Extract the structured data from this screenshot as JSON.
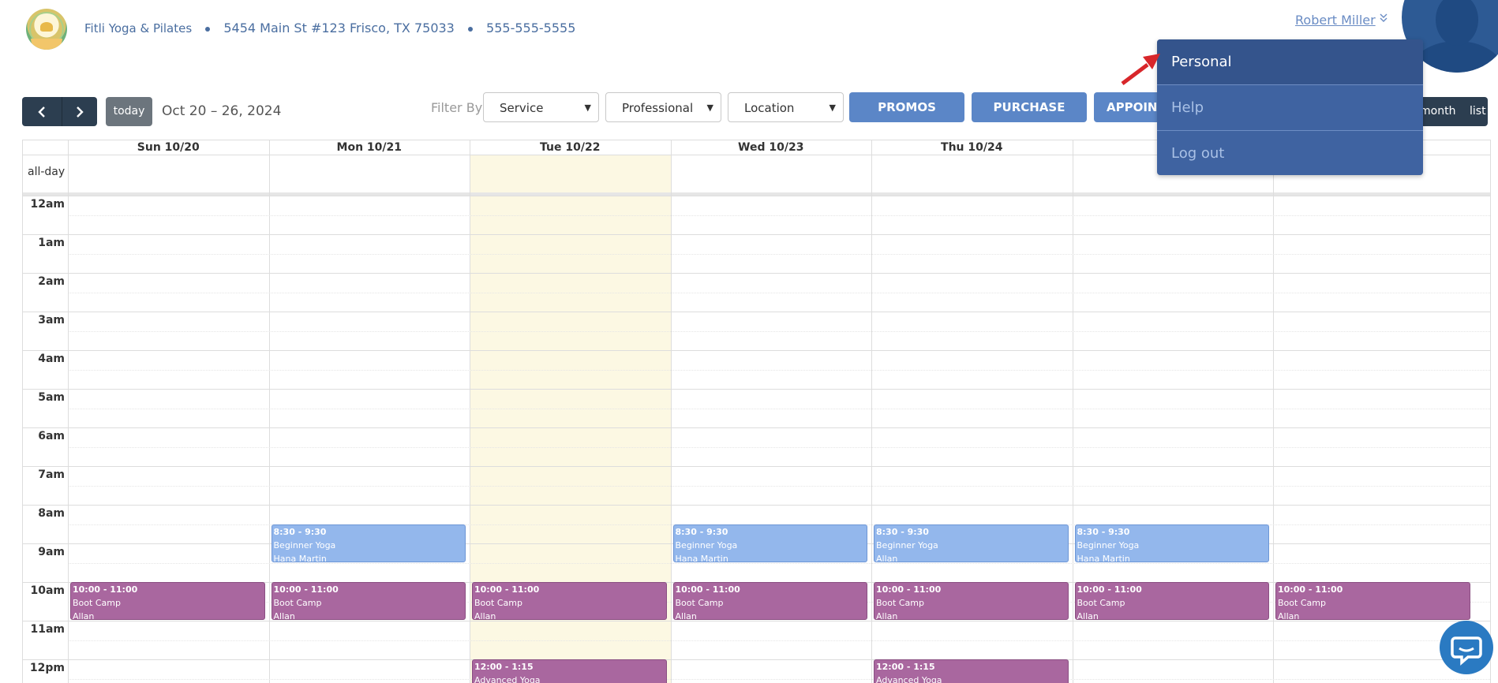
{
  "header": {
    "studio_name": "Fitli Yoga & Pilates",
    "address": "5454 Main St #123 Frisco, TX 75033",
    "phone": "555-555-5555",
    "user_name": "Robert Miller",
    "user_chevron": "»"
  },
  "toolbar": {
    "prev": "‹",
    "next": "›",
    "today": "today",
    "date_range": "Oct 20 – 26, 2024",
    "filter_label": "Filter By",
    "service": "Service",
    "professional": "Professional",
    "location": "Location",
    "promos": "PROMOS",
    "purchase": "PURCHASE",
    "appointments_partial": "APPOINT",
    "view_month": "month",
    "view_list": "list"
  },
  "calendar": {
    "days": [
      "Sun 10/20",
      "Mon 10/21",
      "Tue 10/22",
      "Wed 10/23",
      "Thu 10/24",
      "",
      ""
    ],
    "allday_label": "all-day",
    "hours": [
      "12am",
      "1am",
      "2am",
      "3am",
      "4am",
      "5am",
      "6am",
      "7am",
      "8am",
      "9am",
      "10am",
      "11am",
      "12pm"
    ],
    "events": [
      {
        "day": 1,
        "start": 8.5,
        "end": 9.5,
        "time": "8:30 - 9:30",
        "title": "Beginner Yoga",
        "who": "Hana Martin",
        "kind": "yoga"
      },
      {
        "day": 3,
        "start": 8.5,
        "end": 9.5,
        "time": "8:30 - 9:30",
        "title": "Beginner Yoga",
        "who": "Hana Martin",
        "kind": "yoga"
      },
      {
        "day": 4,
        "start": 8.5,
        "end": 9.5,
        "time": "8:30 - 9:30",
        "title": "Beginner Yoga",
        "who": "Allan",
        "kind": "yoga"
      },
      {
        "day": 5,
        "start": 8.5,
        "end": 9.5,
        "time": "8:30 - 9:30",
        "title": "Beginner Yoga",
        "who": "Hana Martin",
        "kind": "yoga"
      },
      {
        "day": 0,
        "start": 10,
        "end": 11,
        "time": "10:00 - 11:00",
        "title": "Boot Camp",
        "who": "Allan",
        "kind": "boot"
      },
      {
        "day": 1,
        "start": 10,
        "end": 11,
        "time": "10:00 - 11:00",
        "title": "Boot Camp",
        "who": "Allan",
        "kind": "boot"
      },
      {
        "day": 2,
        "start": 10,
        "end": 11,
        "time": "10:00 - 11:00",
        "title": "Boot Camp",
        "who": "Allan",
        "kind": "boot"
      },
      {
        "day": 3,
        "start": 10,
        "end": 11,
        "time": "10:00 - 11:00",
        "title": "Boot Camp",
        "who": "Allan",
        "kind": "boot"
      },
      {
        "day": 4,
        "start": 10,
        "end": 11,
        "time": "10:00 - 11:00",
        "title": "Boot Camp",
        "who": "Allan",
        "kind": "boot"
      },
      {
        "day": 5,
        "start": 10,
        "end": 11,
        "time": "10:00 - 11:00",
        "title": "Boot Camp",
        "who": "Allan",
        "kind": "boot"
      },
      {
        "day": 6,
        "start": 10,
        "end": 11,
        "time": "10:00 - 11:00",
        "title": "Boot Camp",
        "who": "Allan",
        "kind": "boot"
      },
      {
        "day": 2,
        "start": 12,
        "end": 13.25,
        "time": "12:00 - 1:15",
        "title": "Advanced Yoga",
        "who": "",
        "kind": "boot"
      },
      {
        "day": 4,
        "start": 12,
        "end": 13.25,
        "time": "12:00 - 1:15",
        "title": "Advanced Yoga",
        "who": "",
        "kind": "boot"
      }
    ]
  },
  "user_menu": {
    "items": [
      "Personal",
      "Help",
      "Log out"
    ]
  },
  "colors": {
    "primary": "#5b86c7",
    "dark": "#2c3e50",
    "menu": "#3f63a1",
    "today_bg": "#fcf8e3",
    "yoga_event": "#93b7ec",
    "boot_event": "#a9679f"
  },
  "icons": {
    "prev": "chevron-left-icon",
    "next": "chevron-right-icon",
    "user_toggle": "double-chevron-down-icon",
    "chat": "chat-bubble-icon",
    "pointer": "red-arrow-icon"
  }
}
